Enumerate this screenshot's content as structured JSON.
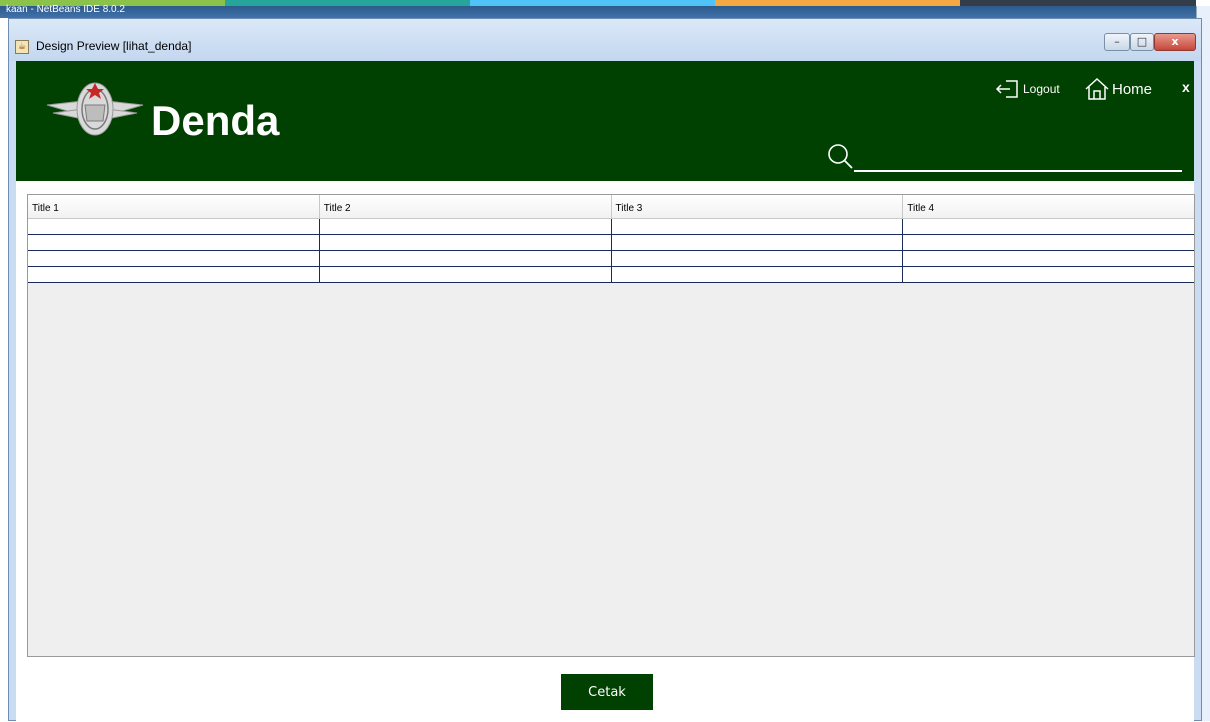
{
  "ide": {
    "title": "kaan - NetBeans IDE 8.0.2"
  },
  "window": {
    "title": "Design Preview [lihat_denda]",
    "controls": {
      "minimize": "–",
      "maximize": "□",
      "close": "x"
    }
  },
  "header": {
    "title": "Denda",
    "logout_label": "Logout",
    "home_label": "Home",
    "close_label": "x",
    "background": "#004000"
  },
  "search": {
    "value": "",
    "placeholder": ""
  },
  "table": {
    "columns": [
      "Title 1",
      "Title 2",
      "Title 3",
      "Title 4"
    ],
    "rows": [
      [
        "",
        "",
        "",
        ""
      ],
      [
        "",
        "",
        "",
        ""
      ],
      [
        "",
        "",
        "",
        ""
      ],
      [
        "",
        "",
        "",
        ""
      ]
    ]
  },
  "actions": {
    "print_label": "Cetak"
  },
  "icons": {
    "logo": "emblem-icon",
    "logout": "logout-icon",
    "home": "home-icon",
    "search": "search-icon"
  }
}
